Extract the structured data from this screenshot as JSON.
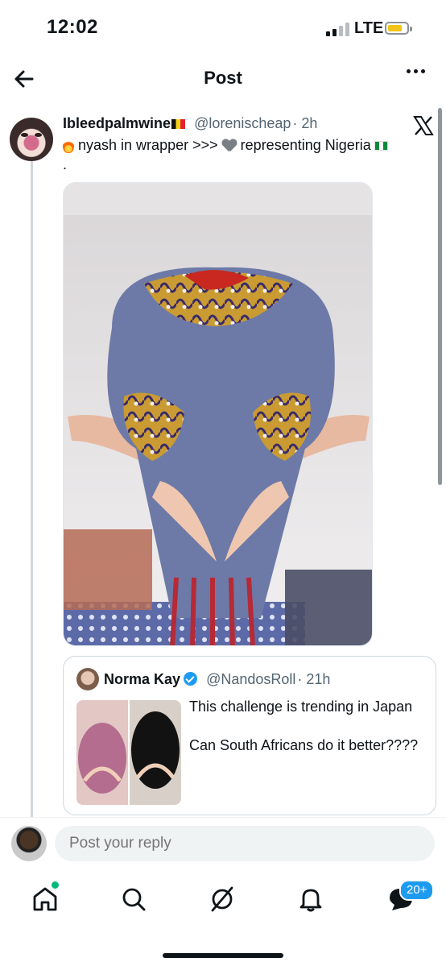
{
  "status_bar": {
    "time": "12:02",
    "network": "LTE",
    "signal_bars": 4,
    "signal_active": 2,
    "battery_level": 0.6,
    "battery_color": "#f2c417"
  },
  "header": {
    "title": "Post",
    "back_icon": "arrow-left-icon",
    "more_icon": "more-horizontal-icon"
  },
  "post": {
    "author_name": "Ibleedpalmwine",
    "author_flag": "flag-belgium",
    "handle": "@lorenischeap",
    "time": "· 2h",
    "text_part1": "nyash in wrapper >>>",
    "text_part2": "representing Nigeria",
    "text_line2": ".",
    "emoji_1": "fire-emoji",
    "emoji_2": "grey-heart-emoji",
    "emoji_3": "flag-nigeria",
    "source_icon": "x-logo-icon"
  },
  "quoted_post": {
    "author_name": "Norma Kay",
    "verified": true,
    "handle": "@NandosRoll",
    "time": "· 21h",
    "text": "This challenge is trending in Japan\n\nCan South Africans do it better????"
  },
  "reply": {
    "placeholder": "Post your reply"
  },
  "tabbar": {
    "items": [
      "home-icon",
      "search-icon",
      "grok-icon",
      "notifications-icon",
      "messages-icon"
    ],
    "messages_badge": "20+",
    "accent": "#1d9bf0",
    "new_dot_color": "#00ba7c"
  }
}
